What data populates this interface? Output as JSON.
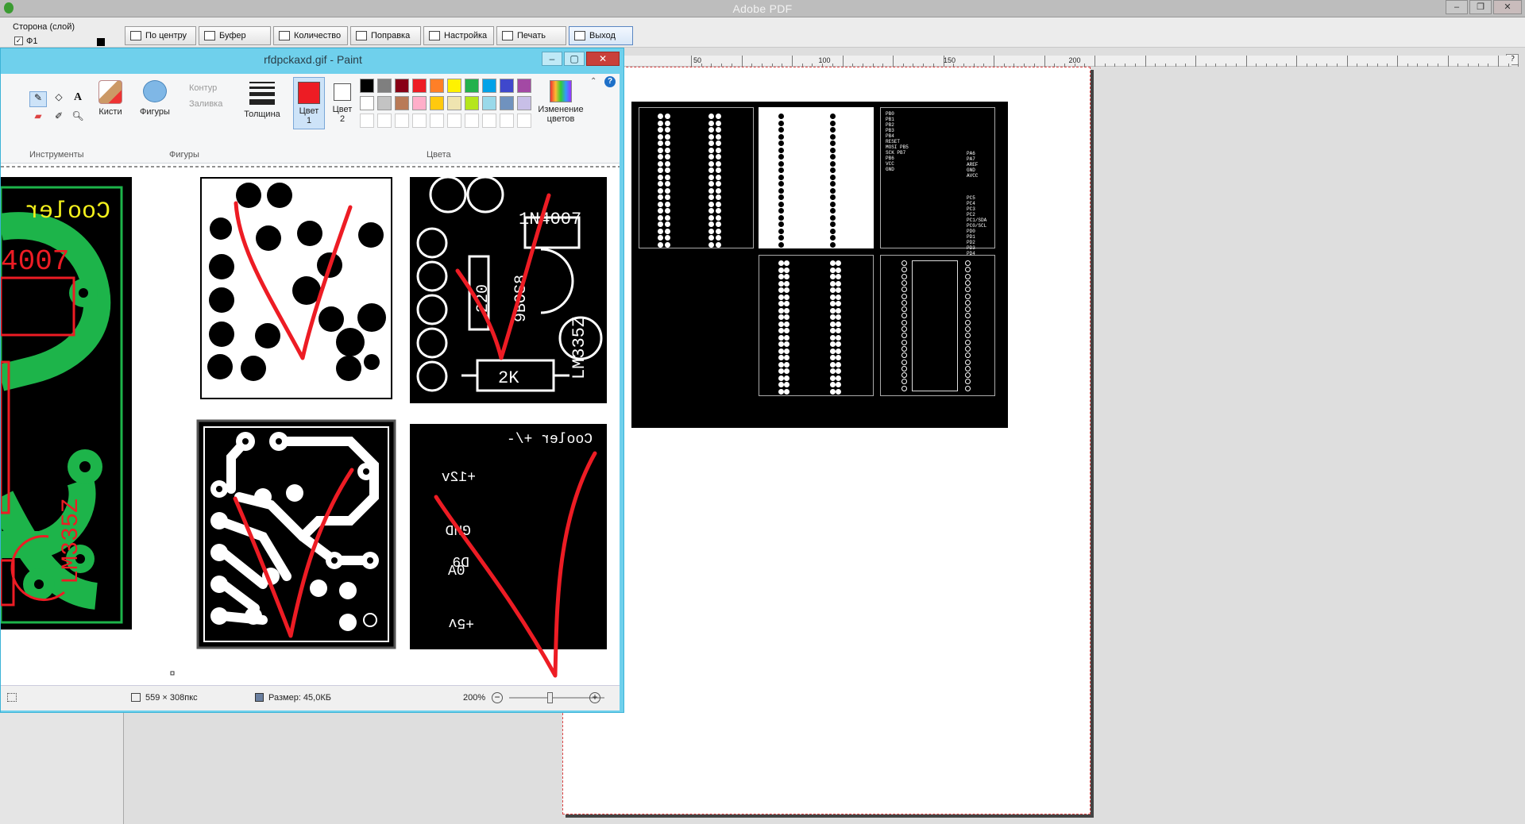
{
  "app": {
    "title": "Adobe PDF"
  },
  "layer_panel": {
    "label": "Сторона (слой)",
    "layer_name": "Ф1"
  },
  "toolbar": [
    {
      "id": "center",
      "label": "По центру"
    },
    {
      "id": "buffer",
      "label": "Буфер"
    },
    {
      "id": "quantity",
      "label": "Количество"
    },
    {
      "id": "correction",
      "label": "Поправка"
    },
    {
      "id": "settings",
      "label": "Настройка"
    },
    {
      "id": "print",
      "label": "Печать"
    },
    {
      "id": "exit",
      "label": "Выход"
    }
  ],
  "ruler": {
    "labels": [
      "50",
      "100",
      "150",
      "200"
    ]
  },
  "workspace": {
    "help_label": "?"
  },
  "paint": {
    "title": "rfdpckaxd.gif - Paint",
    "help_label": "?",
    "ribbon": {
      "tools_group": "Инструменты",
      "brushes": "Кисти",
      "shapes_button": "Фигуры",
      "shapes_group": "Фигуры",
      "outline": "Контур",
      "fill": "Заливка",
      "thickness": "Толщина",
      "color1": "Цвет",
      "color1_num": "1",
      "color2": "Цвет",
      "color2_num": "2",
      "colors_group": "Цвета",
      "edit_colors_1": "Изменение",
      "edit_colors_2": "цветов",
      "color1_value": "#ed1c24",
      "color2_value": "#ffffff",
      "palette_row1": [
        "#000000",
        "#7f7f7f",
        "#880015",
        "#ed1c24",
        "#ff7f27",
        "#fff200",
        "#22b14c",
        "#00a2e8",
        "#3f48cc",
        "#a349a4"
      ],
      "palette_row2": [
        "#ffffff",
        "#c3c3c3",
        "#b97a57",
        "#ffaec9",
        "#ffc90e",
        "#efe4b0",
        "#b5e61d",
        "#99d9ea",
        "#7092be",
        "#c8bfe7"
      ]
    },
    "canvas_text": {
      "cooler": "Cooler",
      "part_code": "4007",
      "diode": "1N4007",
      "resistor_220": "220",
      "transistor": "9BOS8",
      "sensor": "LM335Z",
      "resistor_2k": "2K",
      "cooler_label": "Cooler +/-",
      "pin_12v": "+12v",
      "pin_gnd": "GND",
      "pin_d9": "D9",
      "pin_a0": "A0",
      "pin_5v": "+5v",
      "lm_left": "LM335Z"
    },
    "status": {
      "dimensions": "559 × 308пкс",
      "size": "Размер: 45,0КБ",
      "zoom": "200%"
    }
  },
  "pdf": {
    "port_labels_left": [
      "PB0",
      "PB1",
      "PB2",
      "PB3",
      "PB4",
      "RESET",
      "MOSI PB5",
      "SCK PB7",
      "PB6",
      "VCC",
      "GND"
    ],
    "port_labels_right": [
      "PA6",
      "PA7",
      "AREF",
      "GND",
      "AVCC"
    ],
    "port_labels_bottom": [
      "PC5",
      "PC4",
      "PC3",
      "PC2",
      "PC1/SDA",
      "PC0/SCL",
      "PD0",
      "PD1",
      "PD2",
      "PD3",
      "PD4"
    ]
  }
}
